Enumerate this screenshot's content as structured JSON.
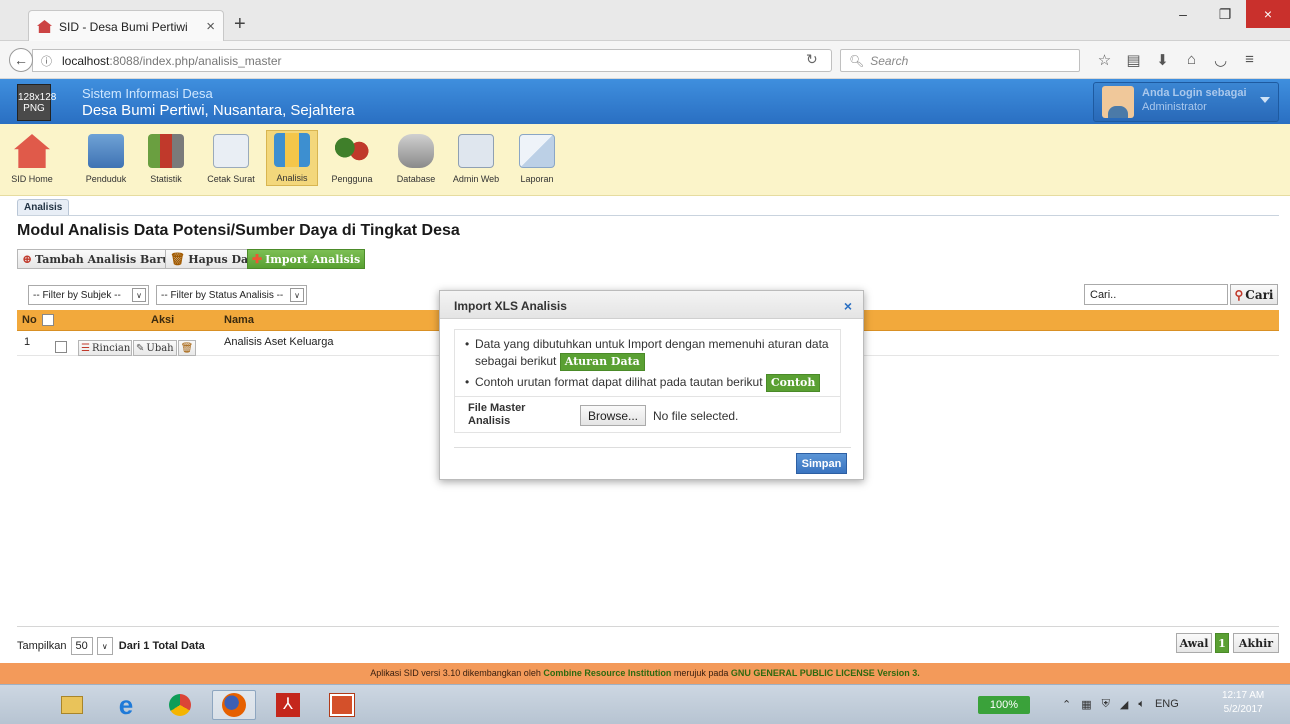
{
  "browser": {
    "tab_title": "SID - Desa Bumi Pertiwi",
    "tab_close": "×",
    "new_tab": "+",
    "url_host": "localhost",
    "url_path": ":8088/index.php/analisis_master",
    "search_placeholder": "Search",
    "window_buttons": [
      "–",
      "❐",
      "×"
    ]
  },
  "header": {
    "logo_text": "128x128 PNG",
    "site_title": "Sistem Informasi Desa",
    "site_subtitle": "Desa Bumi Pertiwi, Nusantara, Sejahtera",
    "login_line1": "Anda Login sebagai",
    "login_line2": "Administrator"
  },
  "toolbar": {
    "items": [
      {
        "label": "SID Home",
        "icon": "home-icon"
      },
      {
        "label": "Penduduk",
        "icon": "population-icon"
      },
      {
        "label": "Statistik",
        "icon": "chart-icon"
      },
      {
        "label": "Cetak Surat",
        "icon": "document-icon"
      },
      {
        "label": "Analisis",
        "icon": "analysis-icon"
      },
      {
        "label": "Pengguna",
        "icon": "users-icon"
      },
      {
        "label": "Database",
        "icon": "database-icon"
      },
      {
        "label": "Admin Web",
        "icon": "admin-web-icon"
      },
      {
        "label": "Laporan",
        "icon": "mail-icon"
      }
    ],
    "active": "Analisis"
  },
  "main": {
    "tab_label": "Analisis",
    "page_title": "Modul Analisis Data Potensi/Sumber Daya di Tingkat Desa",
    "buttons": {
      "tambah": "Tambah Analisis Baru",
      "hapus": "Hapus Data",
      "import": "Import Analisis"
    },
    "filter_subjek": "-- Filter by Subjek --",
    "filter_status": "-- Filter by Status Analisis --",
    "search_value": "Cari..",
    "search_button": "Cari",
    "table": {
      "headers": {
        "no": "No",
        "aksi": "Aksi",
        "nama": "Nama"
      },
      "rows": [
        {
          "no": "1",
          "rincian": "Rincian",
          "ubah": "Ubah",
          "nama": "Analisis Aset Keluarga"
        }
      ]
    }
  },
  "modal": {
    "title": "Import XLS Analisis",
    "close": "×",
    "item1": "Data yang dibutuhkan untuk Import dengan memenuhi aturan data sebagai berikut",
    "item1_button": "Aturan Data",
    "item2": "Contoh urutan format dapat dilihat pada tautan berikut",
    "item2_button": "Contoh",
    "file_label": "File Master Analisis",
    "browse_button": "Browse...",
    "no_file": "No file selected.",
    "save_button": "Simpan"
  },
  "pager": {
    "show_label": "Tampilkan",
    "per_page": "50",
    "of_label": "Dari",
    "total": "1",
    "total_label": "Total Data",
    "first": "Awal",
    "current": "1",
    "last": "Akhir"
  },
  "footer": {
    "text1": "Aplikasi SID versi 3.10 dikembangkan oleh ",
    "org": "Combine Resource Institution",
    "text2": " merujuk pada ",
    "license": "GNU GENERAL PUBLIC LICENSE Version 3."
  },
  "taskbar": {
    "battery": "100%",
    "lang": "ENG",
    "time": "12:17 AM",
    "date": "5/2/2017"
  },
  "colors": {
    "header_blue": "#2a6fc2",
    "toolbar_bg": "#fbf4c9",
    "table_header": "#f2a93c",
    "footer_bg": "#f39a5a",
    "green_button": "#5aa033"
  }
}
